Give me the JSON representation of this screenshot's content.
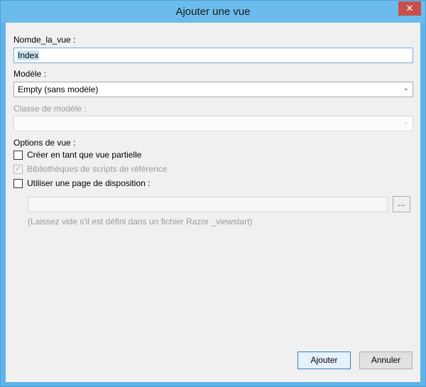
{
  "window": {
    "title": "Ajouter une vue",
    "close_glyph": "✕"
  },
  "view_name": {
    "label": "Nomde_la_vue :",
    "value": "Index"
  },
  "model": {
    "label": "Modèle :",
    "selected": "Empty (sans modèle)"
  },
  "model_class": {
    "label": "Classe de modèle :",
    "selected": ""
  },
  "options": {
    "label": "Options de vue :",
    "partial": {
      "label": "Créer en tant que vue partielle",
      "checked": false
    },
    "scripts": {
      "label": "Bibliothèques de scripts de référence",
      "checked": true,
      "disabled": true
    },
    "layout": {
      "label": "Utiliser une page de disposition :",
      "checked": false
    }
  },
  "layout_path": {
    "value": "",
    "browse_label": "..."
  },
  "hint": "(Laissez vide s'il est défini dans un fichier Razor _viewstart)",
  "buttons": {
    "add": "Ajouter",
    "cancel": "Annuler"
  }
}
